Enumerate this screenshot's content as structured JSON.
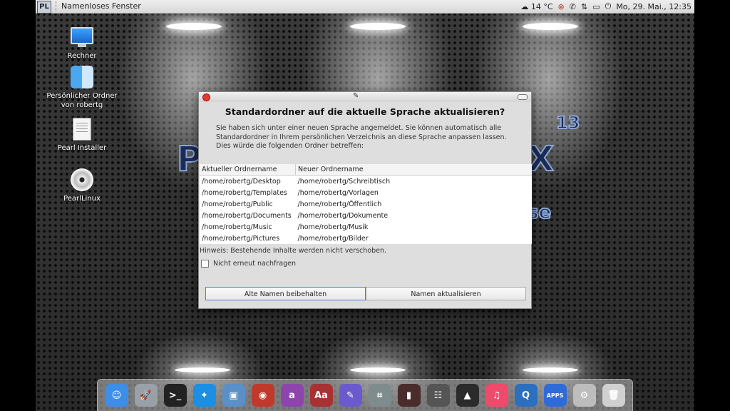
{
  "topbar": {
    "window_title": "Namenloses Fenster",
    "logo_text": "PL",
    "weather": "☁ 14 °C",
    "clock": "Mo, 29. Mai., 12:35"
  },
  "desktop": {
    "icons": [
      {
        "label": "Rechner",
        "icon": "computer-icon"
      },
      {
        "label": "Persönlicher Ordner von robertg",
        "icon": "home-folder-icon"
      },
      {
        "label": "Pearl Installer",
        "icon": "installer-document-icon"
      },
      {
        "label": "PearlLinux",
        "icon": "disc-icon"
      }
    ],
    "logo_version": "13"
  },
  "dialog": {
    "title": "Standardordner auf die aktuelle Sprache aktualisieren?",
    "description": "Sie haben sich unter einer neuen Sprache angemeldet. Sie können automatisch alle Standardordner in Ihrem persönlichen Verzeichnis an diese Sprache anpassen lassen. Dies würde die folgenden Ordner betreffen:",
    "columns": [
      "Aktueller Ordnername",
      "Neuer Ordnername"
    ],
    "rows": [
      [
        "/home/robertg/Desktop",
        "/home/robertg/Schreibtisch"
      ],
      [
        "/home/robertg/Templates",
        "/home/robertg/Vorlagen"
      ],
      [
        "/home/robertg/Public",
        "/home/robertg/Öffentlich"
      ],
      [
        "/home/robertg/Documents",
        "/home/robertg/Dokumente"
      ],
      [
        "/home/robertg/Music",
        "/home/robertg/Musik"
      ],
      [
        "/home/robertg/Pictures",
        "/home/robertg/Bilder"
      ]
    ],
    "hint": "Hinweis: Bestehende Inhalte werden nicht verschoben.",
    "checkbox_label": "Nicht erneut nachfragen",
    "checkbox_checked": false,
    "button_keep": "Alte Namen beibehalten",
    "button_update": "Namen aktualisieren"
  },
  "dock": {
    "items": [
      {
        "name": "finder-icon",
        "color": "#3d8ee8",
        "glyph": "☺"
      },
      {
        "name": "launchpad-icon",
        "color": "#9aa0a8",
        "glyph": "🚀"
      },
      {
        "name": "terminal-icon",
        "color": "#222222",
        "glyph": ">_"
      },
      {
        "name": "safari-icon",
        "color": "#1a8fe3",
        "glyph": "✦"
      },
      {
        "name": "preview-icon",
        "color": "#5b8fc7",
        "glyph": "▣"
      },
      {
        "name": "screenshot-icon",
        "color": "#c0392b",
        "glyph": "◉"
      },
      {
        "name": "font-app-icon",
        "color": "#8e44ad",
        "glyph": "a"
      },
      {
        "name": "dictionary-icon",
        "color": "#a83232",
        "glyph": "Aa"
      },
      {
        "name": "feather-app-icon",
        "color": "#6a5acd",
        "glyph": "✎"
      },
      {
        "name": "image-capture-icon",
        "color": "#7f8c8d",
        "glyph": "⌗"
      },
      {
        "name": "media-app-icon",
        "color": "#4a2c2c",
        "glyph": "▮"
      },
      {
        "name": "mixer-icon",
        "color": "#555555",
        "glyph": "☷"
      },
      {
        "name": "inkscape-icon",
        "color": "#2b2b2b",
        "glyph": "▲"
      },
      {
        "name": "music-icon",
        "color": "#f04a6a",
        "glyph": "♫"
      },
      {
        "name": "quicktime-icon",
        "color": "#2c6fbf",
        "glyph": "Q"
      },
      {
        "name": "apps-store-icon",
        "color": "#2f6bd8",
        "glyph": "APPS"
      },
      {
        "name": "settings-toggle-icon",
        "color": "#bdbdbd",
        "glyph": "⚙"
      },
      {
        "name": "trash-icon",
        "color": "#d0d0d0",
        "glyph": "🗑"
      }
    ]
  }
}
